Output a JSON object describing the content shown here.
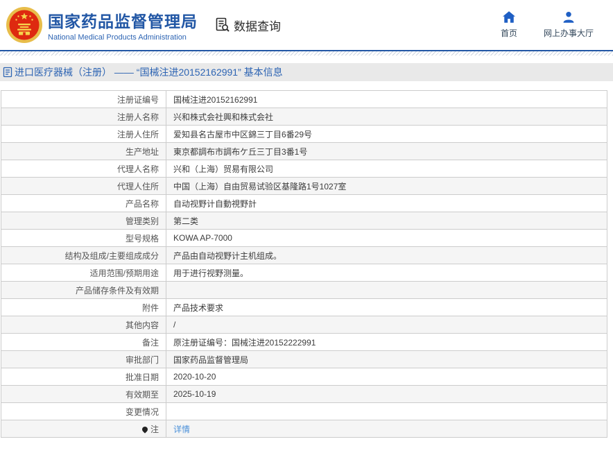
{
  "header": {
    "title": "国家药品监督管理局",
    "subtitle": "National Medical Products Administration",
    "data_query_label": "数据查询",
    "nav": [
      {
        "label": "首页",
        "icon": "home-icon"
      },
      {
        "label": "网上办事大厅",
        "icon": "user-icon"
      }
    ]
  },
  "breadcrumb": {
    "icon": "document-icon",
    "text": "进口医疗器械（注册） —— “国械注进20152162991” 基本信息"
  },
  "table": {
    "rows": [
      {
        "label": "注册证编号",
        "value": "国械注进20152162991"
      },
      {
        "label": "注册人名称",
        "value": "兴和株式会社興和株式会社"
      },
      {
        "label": "注册人住所",
        "value": "爱知县名古屋市中区錦三丁目6番29号"
      },
      {
        "label": "生产地址",
        "value": "東京都調布市調布ケ丘三丁目3番1号"
      },
      {
        "label": "代理人名称",
        "value": "兴和（上海）贸易有限公司"
      },
      {
        "label": "代理人住所",
        "value": "中国（上海）自由贸易试验区基隆路1号1027室"
      },
      {
        "label": "产品名称",
        "value": "自动视野计自動視野計"
      },
      {
        "label": "管理类别",
        "value": "第二类"
      },
      {
        "label": "型号规格",
        "value": "KOWA AP-7000"
      },
      {
        "label": "结构及组成/主要组成成分",
        "value": "产品由自动视野计主机组成。"
      },
      {
        "label": "适用范围/预期用途",
        "value": "用于进行视野测量。"
      },
      {
        "label": "产品储存条件及有效期",
        "value": ""
      },
      {
        "label": "附件",
        "value": "产品技术要求"
      },
      {
        "label": "其他内容",
        "value": "/"
      },
      {
        "label": "备注",
        "value": "原注册证编号：国械注进20152222991"
      },
      {
        "label": "审批部门",
        "value": "国家药品监督管理局"
      },
      {
        "label": "批准日期",
        "value": "2020-10-20"
      },
      {
        "label": "有效期至",
        "value": "2025-10-19"
      },
      {
        "label": "变更情况",
        "value": ""
      },
      {
        "label": "注",
        "label_icon": "pin-icon",
        "value": "详情",
        "link": true
      }
    ]
  },
  "colors": {
    "brand_blue": "#2257a5",
    "icon_blue": "#1f5fc4",
    "breadcrumb_bg": "#e9e9e9",
    "breadcrumb_text": "#2d64b3",
    "table_border": "#cccccc",
    "row_alt_bg": "#f5f5f5",
    "label_text": "#555555",
    "value_text": "#3c3c3c",
    "link_blue": "#4a90d9",
    "emblem_red": "#de2910",
    "emblem_gold": "#e8bd4a"
  }
}
